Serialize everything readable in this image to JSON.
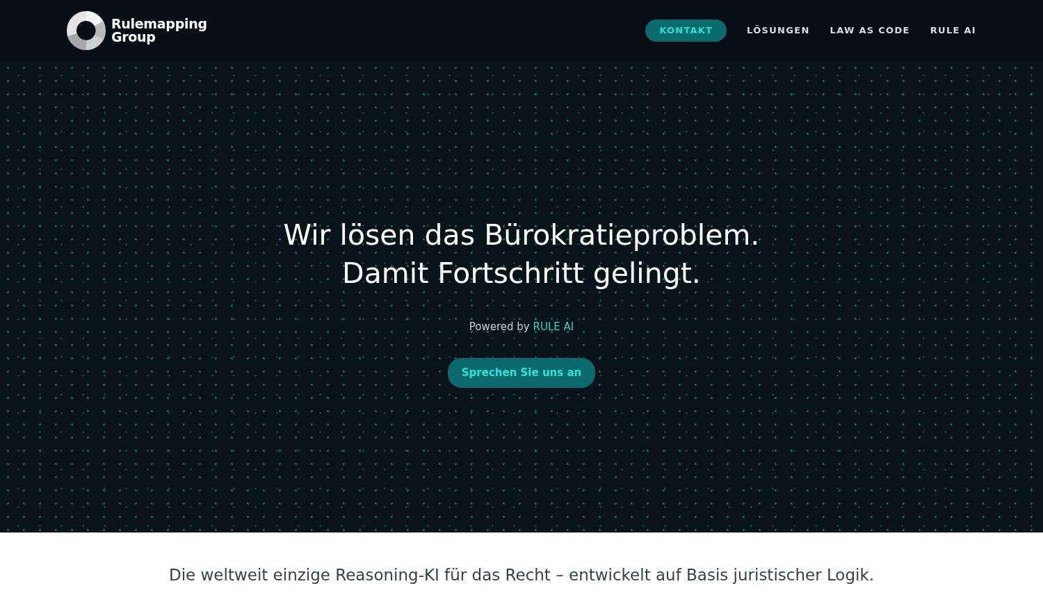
{
  "header": {
    "logo_lines": [
      "Rulemapping",
      "Group"
    ],
    "nav": [
      {
        "label": "KONTAKT",
        "kind": "button"
      },
      {
        "label": "LÖSUNGEN",
        "kind": "link"
      },
      {
        "label": "LAW AS CODE",
        "kind": "link"
      },
      {
        "label": "RULE AI",
        "kind": "link"
      }
    ]
  },
  "hero": {
    "headline_lines": [
      "Wir lösen das Bürokratieproblem.",
      "Damit Fortschritt gelingt."
    ],
    "powered_by": {
      "text": "Powered by",
      "link": "RULE AI"
    },
    "cta": "Sprechen Sie uns an"
  },
  "intro": "Die weltweit einzige Reasoning-KI für das Recht – entwickelt auf Basis juristischer Logik."
}
